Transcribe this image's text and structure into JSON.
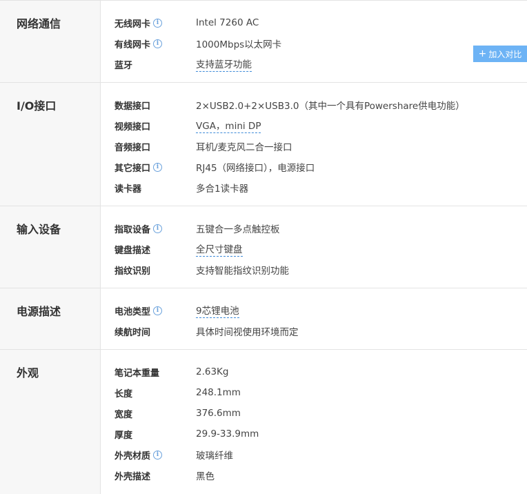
{
  "compare_button": {
    "icon": "plus-icon",
    "label": "加入对比"
  },
  "sections": [
    {
      "title": "网络通信",
      "rows": [
        {
          "label": "无线网卡",
          "info": true,
          "value": "Intel 7260 AC"
        },
        {
          "label": "有线网卡",
          "info": true,
          "value": "1000Mbps以太网卡"
        },
        {
          "label": "蓝牙",
          "info": false,
          "value": "支持蓝牙功能",
          "link": true
        }
      ]
    },
    {
      "title": "I/O接口",
      "rows": [
        {
          "label": "数据接口",
          "info": false,
          "value": "2×USB2.0+2×USB3.0（其中一个具有Powershare供电功能）"
        },
        {
          "label": "视频接口",
          "info": false,
          "value": "VGA，mini DP",
          "link": true
        },
        {
          "label": "音频接口",
          "info": false,
          "value": "耳机/麦克风二合一接口"
        },
        {
          "label": "其它接口",
          "info": true,
          "value": "RJ45（网络接口），电源接口"
        },
        {
          "label": "读卡器",
          "info": false,
          "value": "多合1读卡器"
        }
      ]
    },
    {
      "title": "输入设备",
      "rows": [
        {
          "label": "指取设备",
          "info": true,
          "value": "五键合一多点触控板"
        },
        {
          "label": "键盘描述",
          "info": false,
          "value": "全尺寸键盘",
          "link": true
        },
        {
          "label": "指纹识别",
          "info": false,
          "value": "支持智能指纹识别功能"
        }
      ]
    },
    {
      "title": "电源描述",
      "rows": [
        {
          "label": "电池类型",
          "info": true,
          "value": "9芯锂电池",
          "link": true
        },
        {
          "label": "续航时间",
          "info": false,
          "value": "具体时间视使用环境而定"
        }
      ]
    },
    {
      "title": "外观",
      "rows": [
        {
          "label": "笔记本重量",
          "info": false,
          "value": "2.63Kg"
        },
        {
          "label": "长度",
          "info": false,
          "value": "248.1mm"
        },
        {
          "label": "宽度",
          "info": false,
          "value": "376.6mm"
        },
        {
          "label": "厚度",
          "info": false,
          "value": "29.9-33.9mm"
        },
        {
          "label": "外壳材质",
          "info": true,
          "value": "玻璃纤维"
        },
        {
          "label": "外壳描述",
          "info": false,
          "value": "黑色"
        }
      ]
    }
  ]
}
